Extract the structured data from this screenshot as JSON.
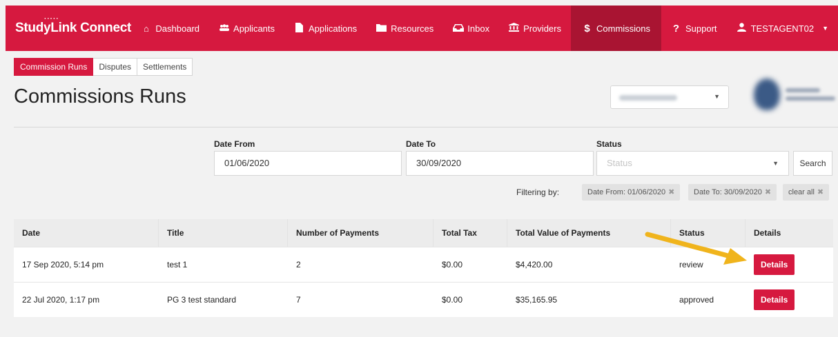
{
  "navbar": {
    "brand": "StudyLink Connect",
    "brand_color": "#d6193f",
    "active_color": "#a91432",
    "items": [
      {
        "label": "Dashboard",
        "icon": "home-icon"
      },
      {
        "label": "Applicants",
        "icon": "users-icon"
      },
      {
        "label": "Applications",
        "icon": "file-icon"
      },
      {
        "label": "Resources",
        "icon": "folder-icon"
      },
      {
        "label": "Inbox",
        "icon": "inbox-icon"
      },
      {
        "label": "Providers",
        "icon": "institution-icon"
      },
      {
        "label": "Commissions",
        "icon": "dollar-icon",
        "active": true
      },
      {
        "label": "Support",
        "icon": "question-icon"
      },
      {
        "label": "TESTAGENT02",
        "icon": "user-icon"
      }
    ]
  },
  "subtabs": [
    {
      "label": "Commission Runs",
      "active": true
    },
    {
      "label": "Disputes"
    },
    {
      "label": "Settlements"
    }
  ],
  "page": {
    "title": "Commissions Runs"
  },
  "filters": {
    "date_from_label": "Date From",
    "date_from_value": "01/06/2020",
    "date_to_label": "Date To",
    "date_to_value": "30/09/2020",
    "status_label": "Status",
    "status_placeholder": "Status",
    "search_label": "Search",
    "filtering_by_label": "Filtering by:",
    "chips": [
      "Date From: 01/06/2020",
      "Date To: 30/09/2020",
      "clear all"
    ]
  },
  "table": {
    "headers": [
      "Date",
      "Title",
      "Number of Payments",
      "Total Tax",
      "Total Value of Payments",
      "Status",
      "Details"
    ],
    "rows": [
      {
        "date": "17 Sep 2020, 5:14 pm",
        "title": "test 1",
        "payments": "2",
        "tax": "$0.00",
        "value": "$4,420.00",
        "status": "review",
        "details": "Details"
      },
      {
        "date": "22 Jul 2020, 1:17 pm",
        "title": "PG 3 test standard",
        "payments": "7",
        "tax": "$0.00",
        "value": "$35,165.95",
        "status": "approved",
        "details": "Details"
      }
    ]
  },
  "annotation": {
    "arrow_color": "#f0b41c"
  }
}
